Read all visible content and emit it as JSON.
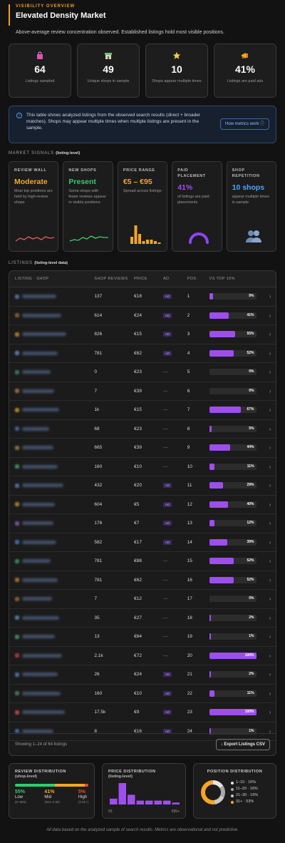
{
  "header": {
    "kicker": "VISIBILITY OVERVIEW",
    "title": "Elevated Density Market",
    "subtitle": "Above-average review concentration observed. Established listings hold most visible positions."
  },
  "stats": [
    {
      "icon": "shopping-bag-icon",
      "value": "64",
      "label": "Listings sampled"
    },
    {
      "icon": "shop-icon",
      "value": "49",
      "label": "Unique shops in sample"
    },
    {
      "icon": "star-icon",
      "value": "10",
      "label": "Shops appear multiple times"
    },
    {
      "icon": "megaphone-icon",
      "value": "41%",
      "label": "Listings are paid ads"
    }
  ],
  "info": {
    "text": "This table shows analyzed listings from the observed search results (direct + broader matches). Shops may appear multiple times when multiple listings are present in the sample.",
    "button": "How metrics work ⓘ"
  },
  "market_signals": {
    "label": "MARKET SIGNALS",
    "sublabel": "(listing-level)",
    "cards": [
      {
        "label": "REVIEW WALL",
        "value": "Moderate",
        "color": "#f5a623",
        "desc": "Most top positions are held by high-review shops"
      },
      {
        "label": "NEW SHOPS",
        "value": "Present",
        "color": "#2ecc71",
        "desc": "Some shops with fewer reviews appear in visible positions"
      },
      {
        "label": "PRICE RANGE",
        "value": "€5 – €95",
        "color": "#f5a623",
        "desc": "Spread across listings"
      },
      {
        "label": "PAID PLACEMENT",
        "value": "41%",
        "color": "#a04ef0",
        "desc": "of listings are paid placements"
      },
      {
        "label": "SHOP REPETITION",
        "value": "10 shops",
        "color": "#4ea3ff",
        "desc": "appear multiple times in sample"
      }
    ]
  },
  "listings": {
    "label": "LISTINGS",
    "sublabel": "(listing-level data)",
    "columns": [
      "LISTING · SHOP",
      "SHOP REVIEWS",
      "PRICE",
      "AD",
      "POS",
      "VS TOP 10%"
    ],
    "ad_label": "AD",
    "rows": [
      {
        "reviews": "137",
        "price": "€18",
        "ad": true,
        "pos": "1",
        "vs": 9
      },
      {
        "reviews": "614",
        "price": "€24",
        "ad": true,
        "pos": "2",
        "vs": 41
      },
      {
        "reviews": "826",
        "price": "€15",
        "ad": true,
        "pos": "3",
        "vs": 55
      },
      {
        "reviews": "781",
        "price": "€62",
        "ad": true,
        "pos": "4",
        "vs": 52
      },
      {
        "reviews": "0",
        "price": "€23",
        "ad": false,
        "pos": "5",
        "vs": 0
      },
      {
        "reviews": "7",
        "price": "€39",
        "ad": false,
        "pos": "6",
        "vs": 0
      },
      {
        "reviews": "1k",
        "price": "€15",
        "ad": false,
        "pos": "7",
        "vs": 67
      },
      {
        "reviews": "68",
        "price": "€23",
        "ad": false,
        "pos": "8",
        "vs": 5
      },
      {
        "reviews": "665",
        "price": "€39",
        "ad": false,
        "pos": "9",
        "vs": 44
      },
      {
        "reviews": "160",
        "price": "€10",
        "ad": false,
        "pos": "10",
        "vs": 11
      },
      {
        "reviews": "432",
        "price": "€20",
        "ad": true,
        "pos": "11",
        "vs": 29
      },
      {
        "reviews": "604",
        "price": "€5",
        "ad": true,
        "pos": "12",
        "vs": 40
      },
      {
        "reviews": "176",
        "price": "€7",
        "ad": true,
        "pos": "13",
        "vs": 12
      },
      {
        "reviews": "582",
        "price": "€17",
        "ad": true,
        "pos": "14",
        "vs": 39
      },
      {
        "reviews": "781",
        "price": "€88",
        "ad": false,
        "pos": "15",
        "vs": 52
      },
      {
        "reviews": "781",
        "price": "€62",
        "ad": false,
        "pos": "16",
        "vs": 52
      },
      {
        "reviews": "7",
        "price": "€12",
        "ad": false,
        "pos": "17",
        "vs": 0
      },
      {
        "reviews": "35",
        "price": "€27",
        "ad": false,
        "pos": "18",
        "vs": 2
      },
      {
        "reviews": "13",
        "price": "€64",
        "ad": false,
        "pos": "19",
        "vs": 1
      },
      {
        "reviews": "2.1k",
        "price": "€72",
        "ad": false,
        "pos": "20",
        "vs": 100
      },
      {
        "reviews": "26",
        "price": "€24",
        "ad": true,
        "pos": "21",
        "vs": 2
      },
      {
        "reviews": "160",
        "price": "€10",
        "ad": true,
        "pos": "22",
        "vs": 11
      },
      {
        "reviews": "17.5k",
        "price": "€9",
        "ad": true,
        "pos": "23",
        "vs": 100
      },
      {
        "reviews": "8",
        "price": "€16",
        "ad": true,
        "pos": "24",
        "vs": 1
      }
    ],
    "showing": "Showing 1–24 of 64 listings",
    "export": "↓ Export Listings CSV"
  },
  "review_distribution": {
    "label": "REVIEW DISTRIBUTION",
    "sublabel": "(shop-level)",
    "segments": [
      {
        "pct": "55%",
        "name": "Low",
        "range": "(0–300)",
        "color": "#2ecc71"
      },
      {
        "pct": "41%",
        "name": "Mid",
        "range": "(301–2.5k)",
        "color": "#f5a623"
      },
      {
        "pct": "5%",
        "name": "High",
        "range": "(2.5k+)",
        "color": "#e74c3c"
      }
    ]
  },
  "price_distribution": {
    "label": "PRICE DISTRIBUTION",
    "sublabel": "(listing-level)",
    "min_label": "€5",
    "max_label": "€95+",
    "bins": [
      3,
      11,
      5,
      2,
      2,
      2,
      2,
      1
    ]
  },
  "position_distribution": {
    "label": "POSITION DISTRIBUTION",
    "items": [
      {
        "label": "1–10 · 16%",
        "color": "#e5e5e5",
        "pct": 16
      },
      {
        "label": "11–20 · 16%",
        "color": "#a8a8a8",
        "pct": 16
      },
      {
        "label": "21–30 · 16%",
        "color": "#c9c9c9",
        "pct": 16
      },
      {
        "label": "31+ · 53%",
        "color": "#f5a623",
        "pct": 53
      }
    ]
  },
  "footnote": "All data based on the analyzed sample of search results. Metrics are observational and not predictive."
}
